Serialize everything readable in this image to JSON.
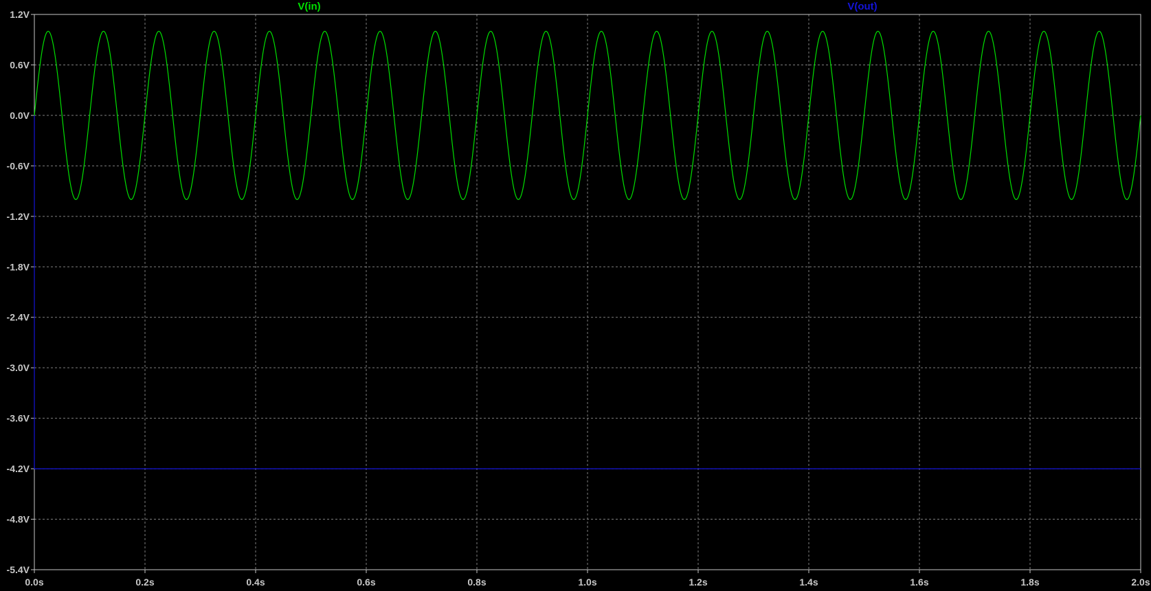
{
  "app": {
    "background": "#000000",
    "grid_color": "#808080",
    "axis_color": "#c8c8c8",
    "tick_label_color": "#c8c8c8"
  },
  "chart_data": {
    "type": "line",
    "title": "",
    "xlabel": "",
    "ylabel": "",
    "xlim": [
      0,
      2.0
    ],
    "ylim": [
      -5.4,
      1.2
    ],
    "grid": true,
    "x_ticks": [
      0.0,
      0.2,
      0.4,
      0.6,
      0.8,
      1.0,
      1.2,
      1.4,
      1.6,
      1.8,
      2.0
    ],
    "x_tick_labels": [
      "0.0s",
      "0.2s",
      "0.4s",
      "0.6s",
      "0.8s",
      "1.0s",
      "1.2s",
      "1.4s",
      "1.6s",
      "1.8s",
      "2.0s"
    ],
    "y_ticks": [
      1.2,
      0.6,
      0.0,
      -0.6,
      -1.2,
      -1.8,
      -2.4,
      -3.0,
      -3.6,
      -4.2,
      -4.8,
      -5.4
    ],
    "y_tick_labels": [
      "1.2V",
      "0.6V",
      "0.0V",
      "-0.6V",
      "-1.2V",
      "-1.8V",
      "-2.4V",
      "-3.0V",
      "-3.6V",
      "-4.2V",
      "-4.8V",
      "-5.4V"
    ],
    "legend": [
      "V(in)",
      "V(out)"
    ],
    "legend_placement": "top",
    "series": [
      {
        "name": "V(in)",
        "color": "#00e000",
        "shape": "sine",
        "amplitude": 1.0,
        "frequency_hz": 10,
        "offset": 0.0,
        "x_start": 0.0,
        "x_end": 2.0
      },
      {
        "name": "V(out)",
        "color": "#1414d8",
        "shape": "step",
        "initial_value": 0.0,
        "final_value": -4.2,
        "x_start": 0.0,
        "x_end": 2.0
      }
    ]
  }
}
